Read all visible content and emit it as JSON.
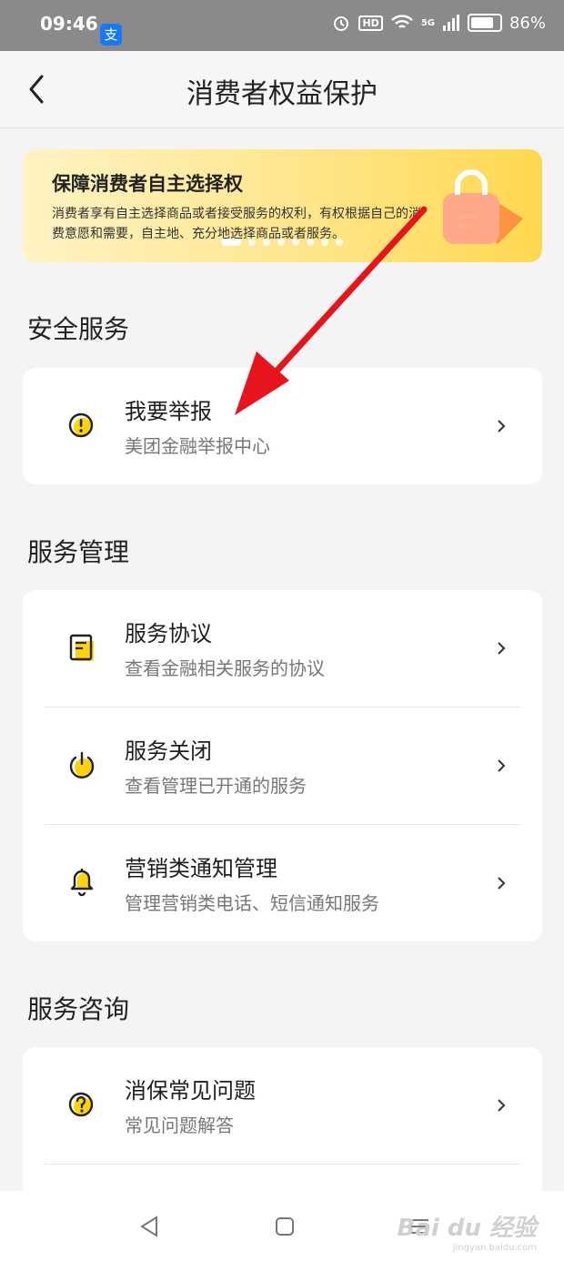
{
  "status": {
    "time": "09:46",
    "alipay_glyph": "支",
    "hd": "HD",
    "network": "5G",
    "battery": "86%"
  },
  "nav": {
    "title": "消费者权益保护",
    "back_icon": "back-chevron-icon"
  },
  "banner": {
    "title": "保障消费者自主选择权",
    "text": "消费者享有自主选择商品或者接受服务的权利，有权根据自己的消费意愿和需要，自主地、充分地选择商品或者服务。"
  },
  "sections": {
    "security": {
      "heading": "安全服务",
      "items": [
        {
          "title": "我要举报",
          "subtitle": "美团金融举报中心",
          "icon": "alert-icon"
        }
      ]
    },
    "management": {
      "heading": "服务管理",
      "items": [
        {
          "title": "服务协议",
          "subtitle": "查看金融相关服务的协议",
          "icon": "document-icon"
        },
        {
          "title": "服务关闭",
          "subtitle": "查看管理已开通的服务",
          "icon": "power-icon"
        },
        {
          "title": "营销类通知管理",
          "subtitle": "管理营销类电话、短信通知服务",
          "icon": "bell-icon"
        }
      ]
    },
    "consult": {
      "heading": "服务咨询",
      "items": [
        {
          "title": "消保常见问题",
          "subtitle": "常见问题解答",
          "icon": "question-icon"
        }
      ]
    }
  },
  "watermark": {
    "brand": "Bai du 经验",
    "url": "jingyan.baidu.com"
  },
  "colors": {
    "accent": "#ffd84f",
    "arrow": "#e8141c",
    "icon_yellow": "#ffd400"
  }
}
